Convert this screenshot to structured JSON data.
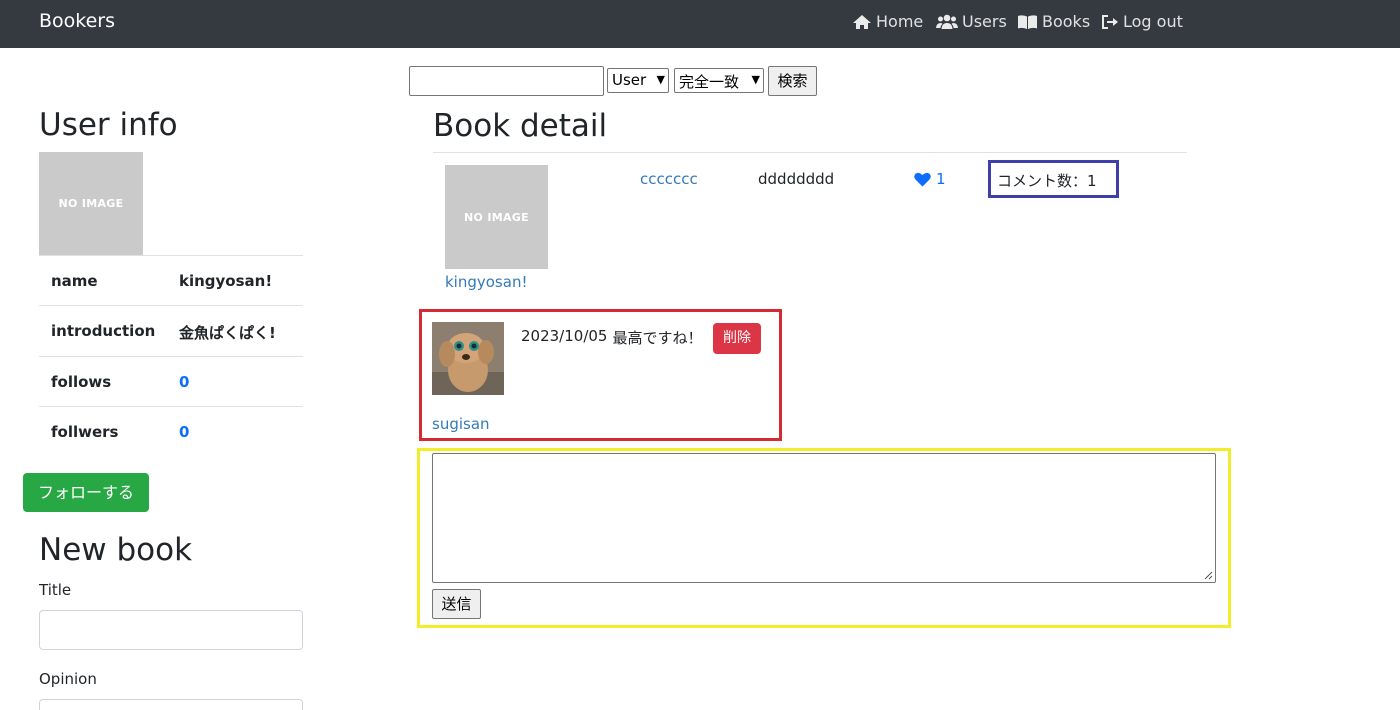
{
  "nav": {
    "brand": "Bookers",
    "links": [
      {
        "label": "Home",
        "icon": "home-icon"
      },
      {
        "label": "Users",
        "icon": "users-icon"
      },
      {
        "label": "Books",
        "icon": "book-icon"
      },
      {
        "label": "Log out",
        "icon": "logout-icon"
      }
    ]
  },
  "search": {
    "value": "",
    "target_selected": "User",
    "method_selected": "完全一致",
    "button": "検索"
  },
  "user_info": {
    "heading": "User info",
    "image_text": "NO IMAGE",
    "rows": [
      {
        "key": "name",
        "value": "kingyosan!"
      },
      {
        "key": "introduction",
        "value": "金魚ぱくぱく!"
      },
      {
        "key": "follows",
        "value": "0"
      },
      {
        "key": "follwers",
        "value": "0"
      }
    ],
    "follow_button": "フォローする"
  },
  "new_book": {
    "heading": "New book",
    "title_label": "Title",
    "opinion_label": "Opinion"
  },
  "book_detail": {
    "heading": "Book detail",
    "image_text": "NO IMAGE",
    "user_name": "kingyosan!",
    "title": "ccccccc",
    "body": "dddddddd",
    "favorite_count": "1",
    "comment_count_text": "コメント数：1"
  },
  "comment": {
    "date": "2023/10/05",
    "text": "最高ですね！",
    "delete_button": "削除",
    "user_name": "sugisan"
  },
  "comment_form": {
    "value": "",
    "submit": "送信"
  },
  "colors": {
    "navbar": "#343a40",
    "follow_green": "#28a745",
    "delete_red": "#dc3545",
    "link_blue": "#337ab7",
    "highlight_blue": "#3f3fa8",
    "highlight_red": "#d42a33",
    "highlight_yellow": "#f2ec2a"
  }
}
